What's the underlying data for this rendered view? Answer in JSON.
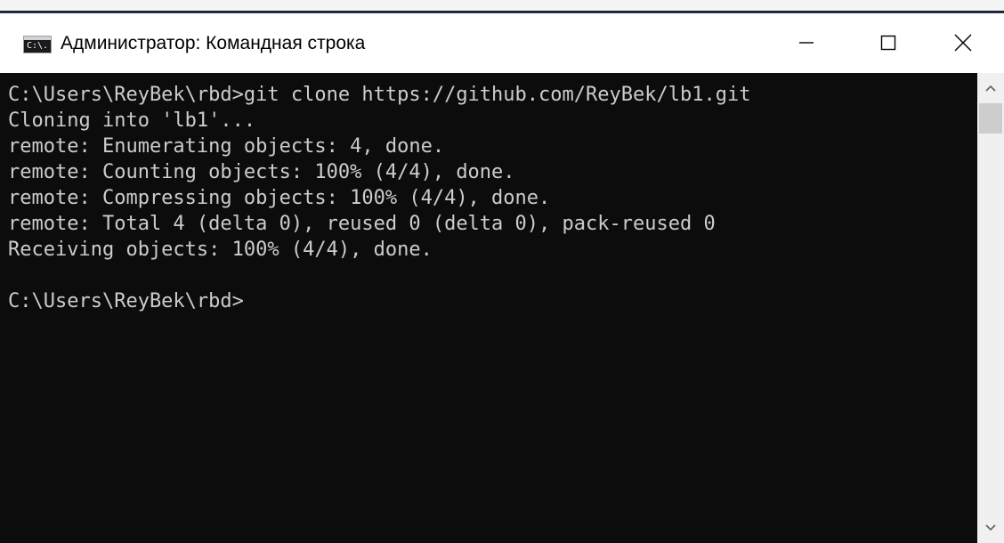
{
  "window": {
    "title": "Администратор: Командная строка",
    "icon": "cmd-icon",
    "icon_glyph": "C:\\."
  },
  "controls": {
    "minimize_icon": "minimize-icon",
    "maximize_icon": "maximize-icon",
    "close_icon": "close-icon"
  },
  "terminal": {
    "lines": [
      "C:\\Users\\ReyBek\\rbd>git clone https://github.com/ReyBek/lb1.git",
      "Cloning into 'lb1'...",
      "remote: Enumerating objects: 4, done.",
      "remote: Counting objects: 100% (4/4), done.",
      "remote: Compressing objects: 100% (4/4), done.",
      "remote: Total 4 (delta 0), reused 0 (delta 0), pack-reused 0",
      "Receiving objects: 100% (4/4), done.",
      "",
      "C:\\Users\\ReyBek\\rbd>"
    ]
  },
  "colors": {
    "terminal_background": "#0c0c0c",
    "terminal_text": "#cccccc",
    "titlebar_background": "#ffffff",
    "scrollbar_track": "#f0f0f0",
    "scrollbar_thumb": "#cdcdcd"
  }
}
